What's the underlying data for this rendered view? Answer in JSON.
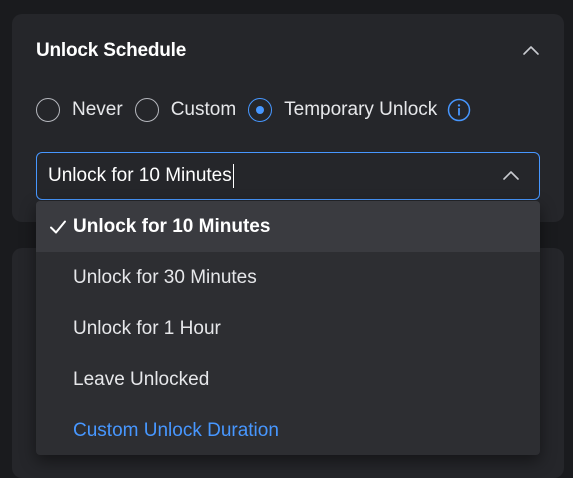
{
  "schedule": {
    "title": "Unlock Schedule",
    "options": [
      {
        "label": "Never",
        "checked": false
      },
      {
        "label": "Custom",
        "checked": false
      },
      {
        "label": "Temporary Unlock",
        "checked": true
      }
    ],
    "info_icon": "info-circle-icon",
    "collapse_icon": "chevron-up-icon"
  },
  "duration_select": {
    "value": "Unlock for 10 Minutes",
    "chevron_icon": "chevron-up-icon",
    "options": [
      {
        "label": "Unlock for 10 Minutes",
        "selected": true
      },
      {
        "label": "Unlock for 30 Minutes",
        "selected": false
      },
      {
        "label": "Unlock for 1 Hour",
        "selected": false
      },
      {
        "label": "Leave Unlocked",
        "selected": false
      },
      {
        "label": "Custom Unlock Duration",
        "selected": false
      }
    ]
  },
  "colors": {
    "accent": "#4797ff",
    "card": "#25262a",
    "background": "#1a1b1e",
    "dropdown": "#2d2e32"
  }
}
